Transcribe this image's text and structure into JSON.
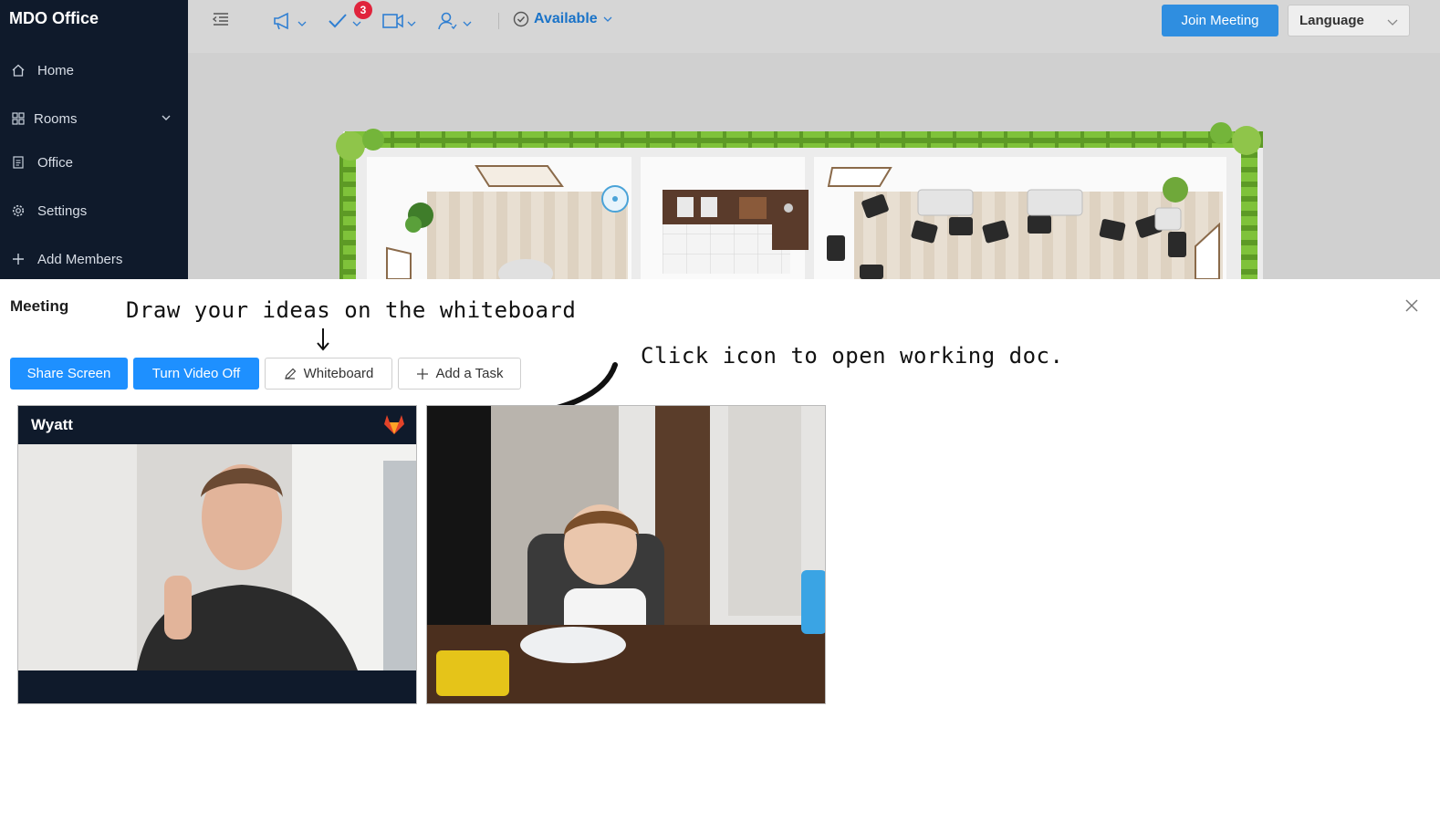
{
  "app": {
    "title": "MDO Office"
  },
  "sidebar": {
    "items": [
      {
        "label": "Home",
        "icon": "home-icon"
      },
      {
        "label": "Rooms",
        "icon": "grid-icon"
      },
      {
        "label": "Office",
        "icon": "document-icon"
      },
      {
        "label": "Settings",
        "icon": "gear-icon"
      },
      {
        "label": "Add Members",
        "icon": "plus-icon"
      }
    ]
  },
  "header": {
    "task_badge_count": "3",
    "status_label": "Available",
    "join_label": "Join Meeting",
    "language_label": "Language"
  },
  "meeting": {
    "title": "Meeting",
    "annotation_whiteboard": "Draw your ideas on the whiteboard",
    "annotation_doc": "Click icon to open working doc.",
    "buttons": {
      "share_screen": "Share Screen",
      "turn_video_off": "Turn Video Off",
      "whiteboard": "Whiteboard",
      "add_task": "Add a Task"
    },
    "participants": [
      {
        "name": "Wyatt",
        "icon": "gitlab-fox-icon"
      },
      {
        "name": ""
      }
    ]
  },
  "colors": {
    "sidebar_bg": "#0f1a2b",
    "header_bg": "#d6d6d6",
    "primary": "#1e90ff",
    "status_blue": "#1a73c8",
    "badge_red": "#e0243c",
    "hedge_green": "#6fae2c"
  }
}
